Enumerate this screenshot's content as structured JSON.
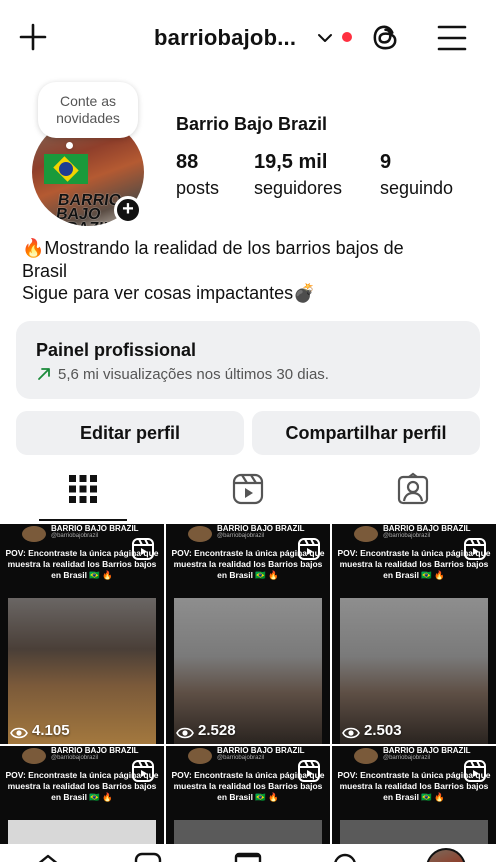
{
  "topbar": {
    "username": "barriobajob...",
    "has_notification_dot": true,
    "icons": [
      "plus-icon",
      "chevron-down-icon",
      "threads-icon",
      "menu-icon"
    ]
  },
  "profile": {
    "note": "Conte as novidades",
    "display_name": "Barrio Bajo Brazil",
    "avatar_text": "BARRIO BAJO BRAZIL",
    "stats": [
      {
        "value": "88",
        "label": "posts"
      },
      {
        "value": "19,5 mil",
        "label": "seguidores"
      },
      {
        "value": "9",
        "label": "seguindo"
      }
    ],
    "bio_lines": [
      "🔥Mostrando la realidad de los barrios bajos de",
      "Brasil",
      "Sigue para ver cosas impactantes💣"
    ]
  },
  "pro_panel": {
    "title": "Painel profissional",
    "subtitle": "5,6 mi visualizações nos últimos 30 dias."
  },
  "buttons": {
    "edit": "Editar perfil",
    "share": "Compartilhar perfil"
  },
  "tabs": [
    "grid-tab",
    "reels-tab",
    "tagged-tab"
  ],
  "posts": [
    {
      "name": "BARRIO BAJO BRAZIL",
      "handle": "@barriobajobrazil",
      "caption": "POV: Encontraste la única página que muestra la realidad los Barrios bajos en Brasil 🇧🇷 🔥",
      "views": "4.105"
    },
    {
      "name": "BARRIO BAJO BRAZIL",
      "handle": "@barriobajobrazil",
      "caption": "POV: Encontraste la única página que muestra la realidad los Barrios bajos en Brasil 🇧🇷 🔥",
      "views": "2.528"
    },
    {
      "name": "BARRIO BAJO BRAZIL",
      "handle": "@barriobajobrazil",
      "caption": "POV: Encontraste la única página que muestra la realidad los Barrios bajos en Brasil 🇧🇷 🔥",
      "views": "2.503"
    },
    {
      "name": "BARRIO BAJO BRAZIL",
      "handle": "@barriobajobrazil",
      "caption": "POV: Encontraste la única página que muestra la realidad los Barrios bajos en Brasil 🇧🇷 🔥",
      "views": ""
    },
    {
      "name": "BARRIO BAJO BRAZIL",
      "handle": "@barriobajobrazil",
      "caption": "POV: Encontraste la única página que muestra la realidad los Barrios bajos en Brasil 🇧🇷 🔥",
      "views": ""
    },
    {
      "name": "BARRIO BAJO BRAZIL",
      "handle": "@barriobajobrazil",
      "caption": "POV: Encontraste la única página que muestra la realidad los Barrios bajos en Brasil 🇧🇷 🔥",
      "views": ""
    }
  ],
  "colors": {
    "notification_dot": "#ff3040",
    "panel_bg": "#eff0f2",
    "trend_green": "#1a8a3a"
  }
}
